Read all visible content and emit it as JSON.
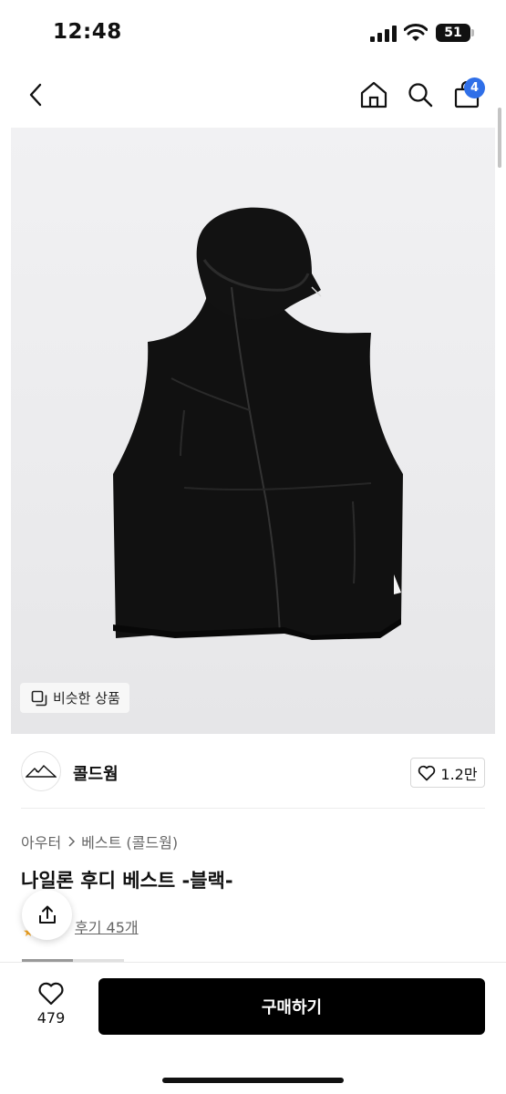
{
  "status": {
    "time": "12:48",
    "battery": "51"
  },
  "header": {
    "cart_count": "4"
  },
  "icons": {
    "back": "chevron-left-icon",
    "home": "home-icon",
    "search": "search-icon",
    "cart": "shopping-bag-icon",
    "similar": "copy-icon",
    "heart": "heart-icon",
    "share": "share-icon",
    "star": "star-icon"
  },
  "colors": {
    "badge": "#2f6fe8",
    "buy_button": "#000000"
  },
  "gallery": {
    "similar_label": "비슷한 상품"
  },
  "brand": {
    "name": "콜드웜",
    "like_count": "1.2만"
  },
  "breadcrumb": {
    "category": "아우터",
    "subcategory": "베스트 (콜드웜)"
  },
  "product": {
    "title": "나일론 후디 베스트 -블랙-",
    "review_label": "후기 45개"
  },
  "bottom": {
    "wish_count": "479",
    "buy_label": "구매하기"
  }
}
